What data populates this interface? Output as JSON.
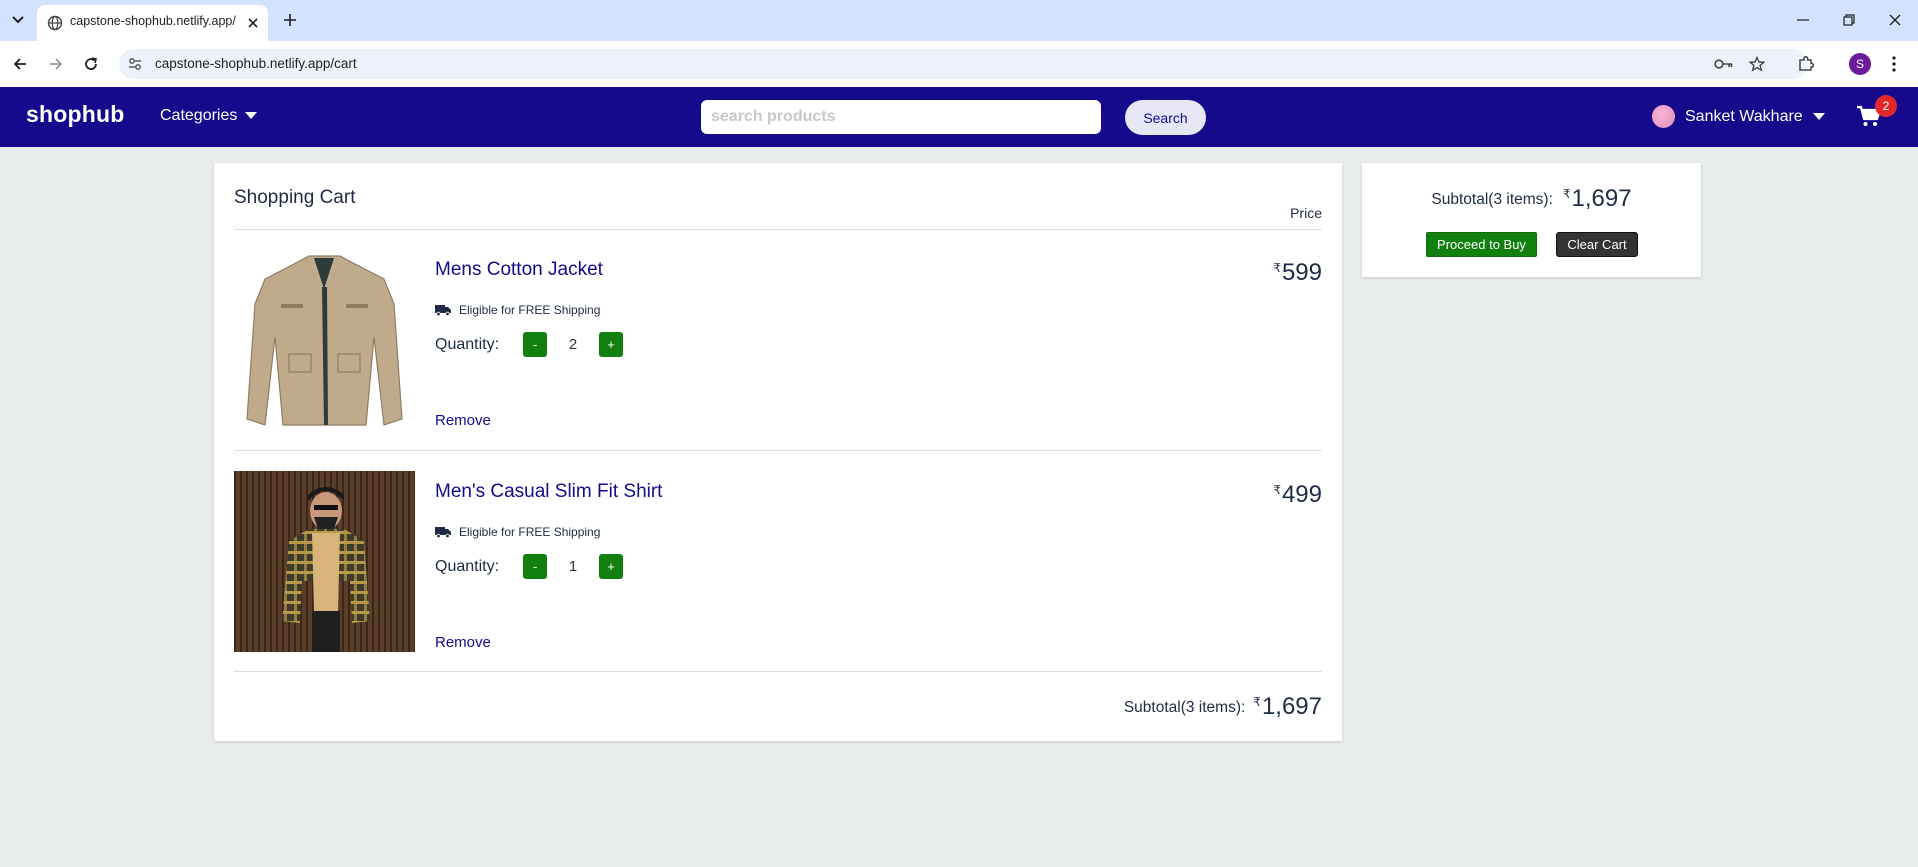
{
  "browser": {
    "tab_title": "capstone-shophub.netlify.app/c",
    "url": "capstone-shophub.netlify.app/cart",
    "profile_initial": "S"
  },
  "header": {
    "logo": "shophub",
    "categories_label": "Categories",
    "search_placeholder": "search products",
    "search_button": "Search",
    "user_name": "Sanket Wakhare",
    "cart_count": "2"
  },
  "cart": {
    "title": "Shopping Cart",
    "price_header": "Price",
    "shipping_text": "Eligible for FREE Shipping",
    "quantity_label": "Quantity:",
    "minus_label": "-",
    "plus_label": "+",
    "remove_label": "Remove",
    "currency_symbol": "₹",
    "items": [
      {
        "name": "Mens Cotton Jacket",
        "price": "599",
        "quantity": "2"
      },
      {
        "name": "Men's Casual Slim Fit Shirt",
        "price": "499",
        "quantity": "1"
      }
    ],
    "subtotal_label": "Subtotal(3 items):",
    "subtotal_amount": "1,697"
  },
  "summary": {
    "subtotal_label": "Subtotal(3 items):",
    "subtotal_amount": "1,697",
    "proceed_button": "Proceed to Buy",
    "clear_button": "Clear Cart"
  },
  "colors": {
    "brand_navy": "#150a8c",
    "buy_green": "#12800f",
    "badge_red": "#e3282b",
    "page_bg": "#e8ecec"
  }
}
